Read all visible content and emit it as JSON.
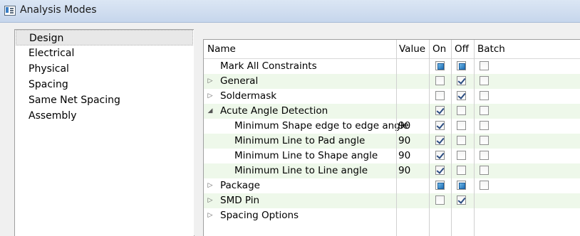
{
  "window": {
    "title": "Analysis Modes"
  },
  "modes": [
    "Design",
    "Electrical",
    "Physical",
    "Spacing",
    "Same Net Spacing",
    "Assembly"
  ],
  "selected_mode": "Design",
  "columns": {
    "name": "Name",
    "value": "Value",
    "on": "On",
    "off": "Off",
    "batch": "Batch"
  },
  "rows": [
    {
      "name": "Mark All Constraints",
      "indent": 0,
      "expander": "none",
      "value": "",
      "on": "partial",
      "off": "partial",
      "batch": "unchecked",
      "alt": false
    },
    {
      "name": "General",
      "indent": 0,
      "expander": "collapsed",
      "value": "",
      "on": "unchecked",
      "off": "checked",
      "batch": "unchecked",
      "alt": true
    },
    {
      "name": "Soldermask",
      "indent": 0,
      "expander": "collapsed",
      "value": "",
      "on": "unchecked",
      "off": "checked",
      "batch": "unchecked",
      "alt": false
    },
    {
      "name": "Acute Angle Detection",
      "indent": 0,
      "expander": "expanded",
      "value": "",
      "on": "checked",
      "off": "unchecked",
      "batch": "unchecked",
      "alt": true
    },
    {
      "name": "Minimum Shape edge to edge angle",
      "indent": 1,
      "expander": "none",
      "value": "90",
      "on": "checked",
      "off": "unchecked",
      "batch": "unchecked",
      "alt": false
    },
    {
      "name": "Minimum Line to Pad angle",
      "indent": 1,
      "expander": "none",
      "value": "90",
      "on": "checked",
      "off": "unchecked",
      "batch": "unchecked",
      "alt": true
    },
    {
      "name": "Minimum Line to Shape angle",
      "indent": 1,
      "expander": "none",
      "value": "90",
      "on": "checked",
      "off": "unchecked",
      "batch": "unchecked",
      "alt": false
    },
    {
      "name": "Minimum Line to Line angle",
      "indent": 1,
      "expander": "none",
      "value": "90",
      "on": "checked",
      "off": "unchecked",
      "batch": "unchecked",
      "alt": true
    },
    {
      "name": "Package",
      "indent": 0,
      "expander": "collapsed",
      "value": "",
      "on": "partial",
      "off": "partial",
      "batch": "unchecked",
      "alt": false
    },
    {
      "name": "SMD Pin",
      "indent": 0,
      "expander": "collapsed",
      "value": "",
      "on": "unchecked",
      "off": "checked",
      "batch": "none",
      "alt": true
    },
    {
      "name": "Spacing Options",
      "indent": 0,
      "expander": "collapsed",
      "value": "",
      "on": "none",
      "off": "none",
      "batch": "none",
      "alt": false
    }
  ],
  "icons": {
    "collapsed": "▷",
    "expanded": "◢",
    "window": "window-app-icon"
  },
  "colors": {
    "alt_row": "#eef8ea",
    "partial_fill": "#1f6fb7"
  }
}
